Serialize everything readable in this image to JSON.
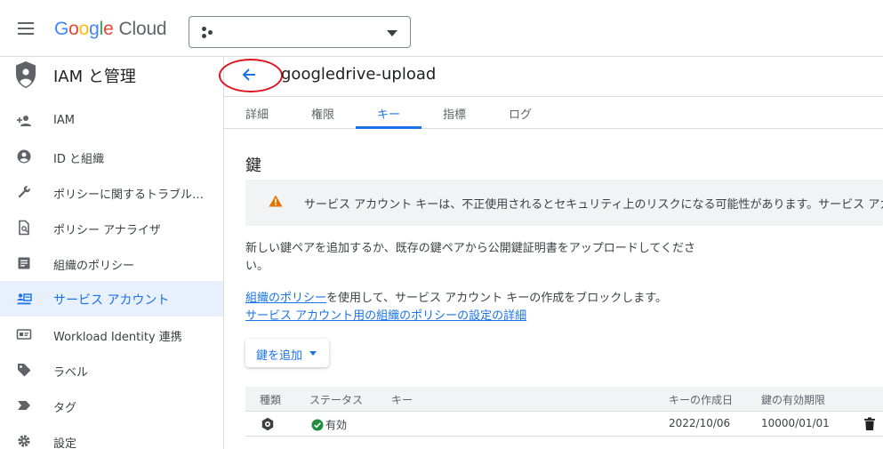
{
  "header": {
    "logo_google": "Google",
    "logo_cloud": "Cloud",
    "project_value": ""
  },
  "sidebar": {
    "title": "IAM と管理",
    "items": [
      {
        "label": "IAM",
        "icon": "person-add-icon"
      },
      {
        "label": "ID と組織",
        "icon": "account-circle-icon"
      },
      {
        "label": "ポリシーに関するトラブルシューティング",
        "icon": "wrench-icon"
      },
      {
        "label": "ポリシー アナライザ",
        "icon": "document-search-icon"
      },
      {
        "label": "組織のポリシー",
        "icon": "list-document-icon"
      },
      {
        "label": "サービス アカウント",
        "icon": "service-account-icon"
      },
      {
        "label": "Workload Identity 連携",
        "icon": "id-card-icon"
      },
      {
        "label": "ラベル",
        "icon": "label-tag-icon"
      },
      {
        "label": "タグ",
        "icon": "tag-arrow-icon"
      },
      {
        "label": "設定",
        "icon": "gear-icon"
      }
    ],
    "active_index": 5
  },
  "page": {
    "title": "googledrive-upload",
    "tabs": [
      "詳細",
      "権限",
      "キー",
      "指標",
      "ログ"
    ],
    "active_tab": 2,
    "section_title": "鍵",
    "alert_text": "サービス アカウント キーは、不正使用されるとセキュリティ上のリスクになる可能性があります。サービス アカ",
    "description": "新しい鍵ペアを追加するか、既存の鍵ペアから公開鍵証明書をアップロードしてください。",
    "policy_link": "組織のポリシー",
    "policy_text": "を使用して、サービス アカウント キーの作成をブロックします。",
    "policy_detail_link": "サービス アカウント用の組織のポリシーの設定の詳細",
    "add_key_label": "鍵を追加"
  },
  "table": {
    "headers": [
      "種類",
      "ステータス",
      "キー",
      "キーの作成日",
      "鍵の有効期限"
    ],
    "rows": [
      {
        "type_icon": "key-type-icon",
        "status": "有効",
        "key": "",
        "created": "2022/10/06",
        "expires": "10000/01/01"
      }
    ]
  },
  "colors": {
    "accent": "#1a73e8",
    "warning": "#e37400",
    "success": "#1e8e3e",
    "annotation": "#e0141e"
  }
}
